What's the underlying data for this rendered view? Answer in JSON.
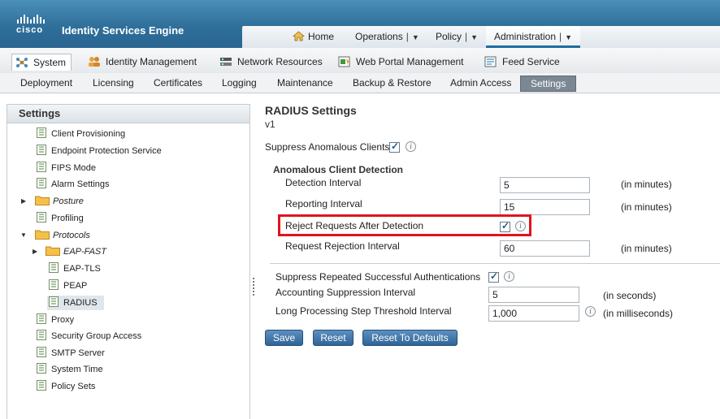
{
  "header": {
    "logo_text": "cisco",
    "title": "Identity Services Engine",
    "nav": [
      {
        "label": "Home",
        "icon": "home-icon"
      },
      {
        "label": "Operations",
        "has_dropdown": true
      },
      {
        "label": "Policy",
        "has_dropdown": true
      },
      {
        "label": "Administration",
        "has_dropdown": true,
        "active": true
      }
    ]
  },
  "subnav1": [
    {
      "label": "System",
      "icon": "system-icon",
      "active": true
    },
    {
      "label": "Identity Management",
      "icon": "users-icon"
    },
    {
      "label": "Network Resources",
      "icon": "network-icon"
    },
    {
      "label": "Web Portal Management",
      "icon": "portal-icon"
    },
    {
      "label": "Feed Service",
      "icon": "feed-icon"
    }
  ],
  "subnav2": [
    {
      "label": "Deployment"
    },
    {
      "label": "Licensing"
    },
    {
      "label": "Certificates"
    },
    {
      "label": "Logging"
    },
    {
      "label": "Maintenance"
    },
    {
      "label": "Backup & Restore"
    },
    {
      "label": "Admin Access"
    },
    {
      "label": "Settings",
      "active": true
    }
  ],
  "sidebar": {
    "title": "Settings",
    "items": [
      {
        "label": "Client Provisioning",
        "type": "doc"
      },
      {
        "label": "Endpoint Protection Service",
        "type": "doc"
      },
      {
        "label": "FIPS Mode",
        "type": "doc"
      },
      {
        "label": "Alarm Settings",
        "type": "doc"
      },
      {
        "label": "Posture",
        "type": "folder",
        "collapsed": true
      },
      {
        "label": "Profiling",
        "type": "doc"
      },
      {
        "label": "Protocols",
        "type": "folder",
        "expanded": true
      },
      {
        "label": "EAP-FAST",
        "type": "folder",
        "collapsed": true
      },
      {
        "label": "EAP-TLS",
        "type": "doc"
      },
      {
        "label": "PEAP",
        "type": "doc"
      },
      {
        "label": "RADIUS",
        "type": "doc",
        "selected": true
      },
      {
        "label": "Proxy",
        "type": "doc"
      },
      {
        "label": "Security Group Access",
        "type": "doc"
      },
      {
        "label": "SMTP Server",
        "type": "doc"
      },
      {
        "label": "System Time",
        "type": "doc"
      },
      {
        "label": "Policy Sets",
        "type": "doc"
      }
    ]
  },
  "main": {
    "title": "RADIUS Settings",
    "subtitle": "v1",
    "suppress_anomalous": {
      "label": "Suppress Anomalous Clients",
      "checked": true
    },
    "anomalous_section": {
      "heading": "Anomalous Client Detection",
      "detection_interval": {
        "label": "Detection Interval",
        "value": "5",
        "unit": "(in minutes)"
      },
      "reporting_interval": {
        "label": "Reporting Interval",
        "value": "15",
        "unit": "(in minutes)"
      },
      "reject_requests": {
        "label": "Reject Requests After Detection",
        "checked": true
      },
      "request_rejection_interval": {
        "label": "Request Rejection Interval",
        "value": "60",
        "unit": "(in minutes)"
      }
    },
    "suppress_repeated": {
      "label": "Suppress Repeated Successful Authentications",
      "checked": true
    },
    "accounting_suppression": {
      "label": "Accounting Suppression Interval",
      "value": "5",
      "unit": "(in seconds)"
    },
    "long_processing": {
      "label": "Long Processing Step Threshold Interval",
      "value": "1,000",
      "unit": "(in milliseconds)"
    },
    "buttons": {
      "save": "Save",
      "reset": "Reset",
      "reset_defaults": "Reset To Defaults"
    }
  },
  "colors": {
    "highlight_border": "#e0141e",
    "header_blue": "#2f6f9a",
    "button_blue": "#2f6597"
  }
}
